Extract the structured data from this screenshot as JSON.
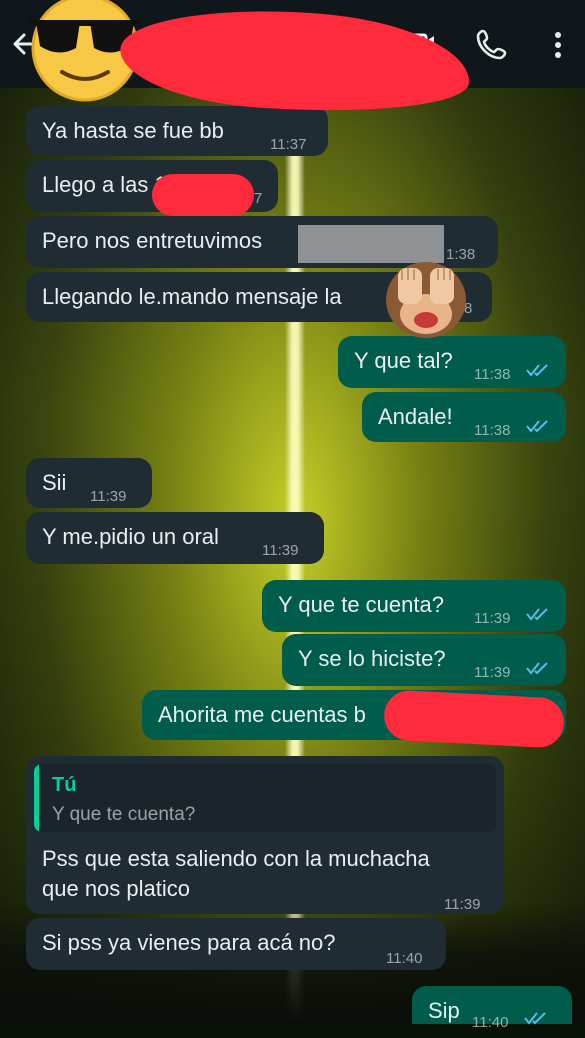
{
  "header": {
    "icons": {
      "back": "arrow-left-icon",
      "video": "video-camera-icon",
      "call": "phone-icon",
      "menu": "more-vertical-icon",
      "avatar": "sunglasses-emoji"
    }
  },
  "colors": {
    "header_bg": "#0f171b",
    "incoming_bubble": "#1f2c33",
    "outgoing_bubble": "#005c4b",
    "read_ticks": "#53bdeb",
    "quote_accent": "#06cf9c",
    "redaction": "#ff2a3b"
  },
  "messages": [
    {
      "dir": "in",
      "text": "Ya hasta se fue bb",
      "time": "11:37"
    },
    {
      "dir": "in",
      "text": "Llego a las 1",
      "time": "7",
      "redacted": true
    },
    {
      "dir": "in",
      "text": "Pero nos entretuvimos",
      "time": "1:38",
      "redacted": true
    },
    {
      "dir": "in",
      "text": "Llegando le.mando mensaje la",
      "time": "8",
      "redacted": true
    },
    {
      "dir": "out",
      "text": "Y que tal?",
      "time": "11:38",
      "status": "read"
    },
    {
      "dir": "out",
      "text": "Andale!",
      "time": "11:38",
      "status": "read"
    },
    {
      "dir": "in",
      "text": "Sii",
      "time": "11:39"
    },
    {
      "dir": "in",
      "text": "Y me.pidio un oral",
      "time": "11:39"
    },
    {
      "dir": "out",
      "text": "Y que te cuenta?",
      "time": "11:39",
      "status": "read"
    },
    {
      "dir": "out",
      "text": "Y se lo hiciste?",
      "time": "11:39",
      "status": "read"
    },
    {
      "dir": "out",
      "text": "Ahorita me cuentas b",
      "redacted": true
    },
    {
      "dir": "in",
      "quote_author": "Tú",
      "quote_text": "Y que te cuenta?",
      "text_line1": "Pss que esta saliendo con la muchacha",
      "text_line2": "que nos platico",
      "time": "11:39"
    },
    {
      "dir": "in",
      "text": "Si pss ya vienes para acá no?",
      "time": "11:40"
    },
    {
      "dir": "out",
      "text": "Sip",
      "time": "11:40",
      "status": "read"
    }
  ]
}
